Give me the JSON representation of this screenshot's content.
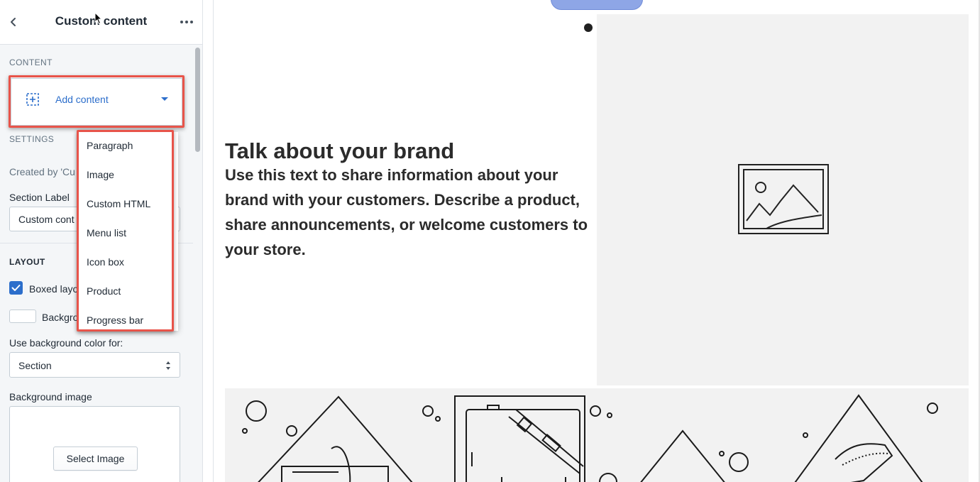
{
  "sidebar": {
    "title": "Custom content",
    "back_icon": "chevron-left-icon",
    "more_icon": "more-horizontal-icon",
    "content_label": "CONTENT",
    "add_content": {
      "label": "Add content",
      "icon": "add-block-icon",
      "caret": "caret-down-icon"
    },
    "settings_label": "SETTINGS",
    "created_by": "Created by 'Cu",
    "section_label": {
      "label": "Section Label",
      "value": "Custom cont"
    },
    "layout_label": "LAYOUT",
    "boxed_layout": {
      "label": "Boxed layo",
      "checked": true
    },
    "background": {
      "label": "Backgro",
      "color": "#ffffff"
    },
    "bg_use": {
      "label": "Use background color for:",
      "value": "Section"
    },
    "bg_image": {
      "label": "Background image",
      "button": "Select Image"
    }
  },
  "dropdown": {
    "items": [
      "Paragraph",
      "Image",
      "Custom HTML",
      "Menu list",
      "Icon box",
      "Product",
      "Progress bar"
    ]
  },
  "preview": {
    "title": "Talk about your brand",
    "text": "Use this text to share information about your brand with your customers. Describe a product, share announcements, or welcome customers to your store.",
    "slides": {
      "active": 1,
      "total": 2
    },
    "image_icon": "image-placeholder-icon"
  },
  "colors": {
    "accent": "#2c6ecb",
    "highlight": "#e8544a",
    "pill": "#8ea6e6",
    "placeholder_bg": "#f2f2f2"
  }
}
